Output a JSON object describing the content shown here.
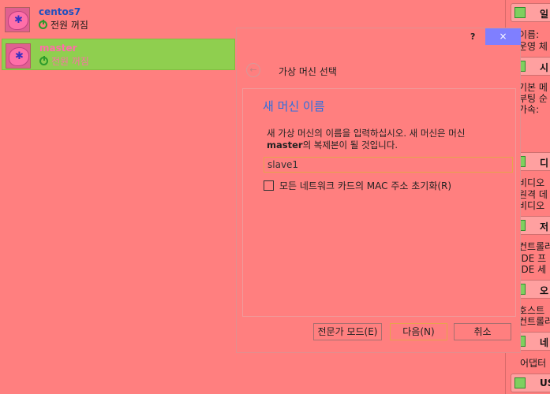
{
  "vm_list": [
    {
      "name": "centos7",
      "state": "전원 꺼짐",
      "selected": false
    },
    {
      "name": "master",
      "state": "전원 꺼짐",
      "selected": true
    }
  ],
  "details": {
    "sections": [
      {
        "title": "일",
        "lines": [
          "이름:",
          "운영 체"
        ]
      },
      {
        "title": "시",
        "lines": [
          "기본 메",
          "부팅 순",
          "가속:"
        ]
      },
      {
        "title": "디",
        "lines": [
          "비디오",
          "원격 데",
          "비디오"
        ]
      },
      {
        "title": "저",
        "lines": [
          "컨트롤러",
          "IDE 프",
          "IDE 세"
        ]
      },
      {
        "title": "오",
        "lines": [
          "호스트",
          "컨트롤러"
        ]
      },
      {
        "title": "네",
        "lines": [
          "어댑터"
        ]
      },
      {
        "title": "US",
        "lines": []
      }
    ]
  },
  "dialog": {
    "help": "?",
    "close": "×",
    "back": "←",
    "title": "가상 머신 선택",
    "page_heading": "새 머신 이름",
    "desc_part1": "새 가상 머신의 이름을 입력하십시오. 새 머신은 머신",
    "desc_bold": "master",
    "desc_part2": "의 복제본이 될 것입니다.",
    "name_value": "slave1",
    "mac_checkbox_label": "모든 네트워크 카드의 MAC 주소 초기화(R)",
    "mac_checked": false,
    "buttons": {
      "expert": "전문가 모드(E)",
      "next": "다음(N)",
      "cancel": "취소"
    }
  }
}
